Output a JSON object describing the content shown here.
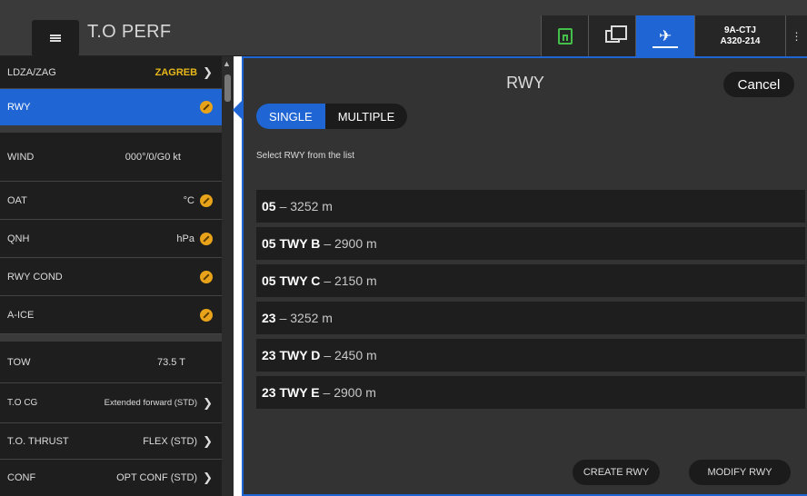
{
  "header": {
    "title": "T.O PERF",
    "aircraft_reg": "9A-CTJ",
    "aircraft_type": "A320-214"
  },
  "colors": {
    "accent": "#1f66d4",
    "warning": "#e8a31a",
    "airport": "#e8b81a",
    "save": "#44c04a"
  },
  "sidebar": {
    "items": [
      {
        "label": "LDZA/ZAG",
        "value": "ZAGREB"
      },
      {
        "label": "RWY",
        "value": ""
      },
      {
        "label": "WIND",
        "value": "000°/0/G0 kt"
      },
      {
        "label": "OAT",
        "value": "°C"
      },
      {
        "label": "QNH",
        "value": "hPa"
      },
      {
        "label": "RWY COND",
        "value": ""
      },
      {
        "label": "A-ICE",
        "value": ""
      },
      {
        "label": "TOW",
        "value": "73.5 T"
      },
      {
        "label": "T.O CG",
        "value": "Extended forward (STD)"
      },
      {
        "label": "T.O. THRUST",
        "value": "FLEX (STD)"
      },
      {
        "label": "CONF",
        "value": "OPT CONF (STD)"
      }
    ]
  },
  "panel": {
    "title": "RWY",
    "cancel_label": "Cancel",
    "mode_single": "SINGLE",
    "mode_multiple": "MULTIPLE",
    "instruction": "Select RWY from the list",
    "runways": [
      {
        "id": "05",
        "length": "– 3252 m"
      },
      {
        "id": "05 TWY B",
        "length": "– 2900 m"
      },
      {
        "id": "05 TWY C",
        "length": "– 2150 m"
      },
      {
        "id": "23",
        "length": "– 3252 m"
      },
      {
        "id": "23 TWY D",
        "length": "– 2450 m"
      },
      {
        "id": "23 TWY E",
        "length": "– 2900 m"
      }
    ],
    "create_label": "CREATE RWY",
    "modify_label": "MODIFY RWY"
  }
}
